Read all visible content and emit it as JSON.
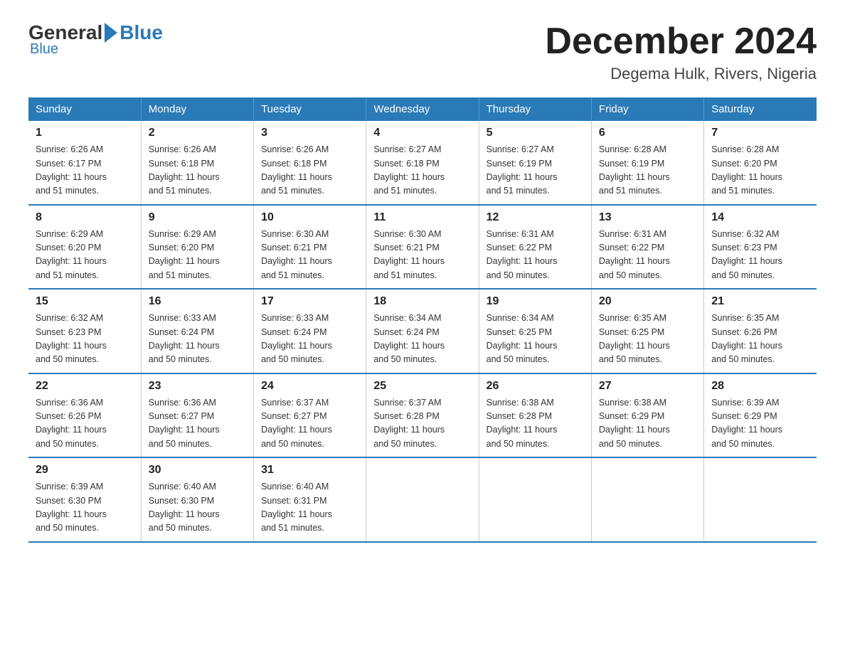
{
  "header": {
    "logo_general": "General",
    "logo_blue": "Blue",
    "month_title": "December 2024",
    "location": "Degema Hulk, Rivers, Nigeria"
  },
  "days_of_week": [
    "Sunday",
    "Monday",
    "Tuesday",
    "Wednesday",
    "Thursday",
    "Friday",
    "Saturday"
  ],
  "weeks": [
    [
      {
        "day": "1",
        "sunrise": "6:26 AM",
        "sunset": "6:17 PM",
        "daylight": "11 hours and 51 minutes."
      },
      {
        "day": "2",
        "sunrise": "6:26 AM",
        "sunset": "6:18 PM",
        "daylight": "11 hours and 51 minutes."
      },
      {
        "day": "3",
        "sunrise": "6:26 AM",
        "sunset": "6:18 PM",
        "daylight": "11 hours and 51 minutes."
      },
      {
        "day": "4",
        "sunrise": "6:27 AM",
        "sunset": "6:18 PM",
        "daylight": "11 hours and 51 minutes."
      },
      {
        "day": "5",
        "sunrise": "6:27 AM",
        "sunset": "6:19 PM",
        "daylight": "11 hours and 51 minutes."
      },
      {
        "day": "6",
        "sunrise": "6:28 AM",
        "sunset": "6:19 PM",
        "daylight": "11 hours and 51 minutes."
      },
      {
        "day": "7",
        "sunrise": "6:28 AM",
        "sunset": "6:20 PM",
        "daylight": "11 hours and 51 minutes."
      }
    ],
    [
      {
        "day": "8",
        "sunrise": "6:29 AM",
        "sunset": "6:20 PM",
        "daylight": "11 hours and 51 minutes."
      },
      {
        "day": "9",
        "sunrise": "6:29 AM",
        "sunset": "6:20 PM",
        "daylight": "11 hours and 51 minutes."
      },
      {
        "day": "10",
        "sunrise": "6:30 AM",
        "sunset": "6:21 PM",
        "daylight": "11 hours and 51 minutes."
      },
      {
        "day": "11",
        "sunrise": "6:30 AM",
        "sunset": "6:21 PM",
        "daylight": "11 hours and 51 minutes."
      },
      {
        "day": "12",
        "sunrise": "6:31 AM",
        "sunset": "6:22 PM",
        "daylight": "11 hours and 50 minutes."
      },
      {
        "day": "13",
        "sunrise": "6:31 AM",
        "sunset": "6:22 PM",
        "daylight": "11 hours and 50 minutes."
      },
      {
        "day": "14",
        "sunrise": "6:32 AM",
        "sunset": "6:23 PM",
        "daylight": "11 hours and 50 minutes."
      }
    ],
    [
      {
        "day": "15",
        "sunrise": "6:32 AM",
        "sunset": "6:23 PM",
        "daylight": "11 hours and 50 minutes."
      },
      {
        "day": "16",
        "sunrise": "6:33 AM",
        "sunset": "6:24 PM",
        "daylight": "11 hours and 50 minutes."
      },
      {
        "day": "17",
        "sunrise": "6:33 AM",
        "sunset": "6:24 PM",
        "daylight": "11 hours and 50 minutes."
      },
      {
        "day": "18",
        "sunrise": "6:34 AM",
        "sunset": "6:24 PM",
        "daylight": "11 hours and 50 minutes."
      },
      {
        "day": "19",
        "sunrise": "6:34 AM",
        "sunset": "6:25 PM",
        "daylight": "11 hours and 50 minutes."
      },
      {
        "day": "20",
        "sunrise": "6:35 AM",
        "sunset": "6:25 PM",
        "daylight": "11 hours and 50 minutes."
      },
      {
        "day": "21",
        "sunrise": "6:35 AM",
        "sunset": "6:26 PM",
        "daylight": "11 hours and 50 minutes."
      }
    ],
    [
      {
        "day": "22",
        "sunrise": "6:36 AM",
        "sunset": "6:26 PM",
        "daylight": "11 hours and 50 minutes."
      },
      {
        "day": "23",
        "sunrise": "6:36 AM",
        "sunset": "6:27 PM",
        "daylight": "11 hours and 50 minutes."
      },
      {
        "day": "24",
        "sunrise": "6:37 AM",
        "sunset": "6:27 PM",
        "daylight": "11 hours and 50 minutes."
      },
      {
        "day": "25",
        "sunrise": "6:37 AM",
        "sunset": "6:28 PM",
        "daylight": "11 hours and 50 minutes."
      },
      {
        "day": "26",
        "sunrise": "6:38 AM",
        "sunset": "6:28 PM",
        "daylight": "11 hours and 50 minutes."
      },
      {
        "day": "27",
        "sunrise": "6:38 AM",
        "sunset": "6:29 PM",
        "daylight": "11 hours and 50 minutes."
      },
      {
        "day": "28",
        "sunrise": "6:39 AM",
        "sunset": "6:29 PM",
        "daylight": "11 hours and 50 minutes."
      }
    ],
    [
      {
        "day": "29",
        "sunrise": "6:39 AM",
        "sunset": "6:30 PM",
        "daylight": "11 hours and 50 minutes."
      },
      {
        "day": "30",
        "sunrise": "6:40 AM",
        "sunset": "6:30 PM",
        "daylight": "11 hours and 50 minutes."
      },
      {
        "day": "31",
        "sunrise": "6:40 AM",
        "sunset": "6:31 PM",
        "daylight": "11 hours and 51 minutes."
      },
      null,
      null,
      null,
      null
    ]
  ],
  "labels": {
    "sunrise_prefix": "Sunrise: ",
    "sunset_prefix": "Sunset: ",
    "daylight_prefix": "Daylight: "
  }
}
